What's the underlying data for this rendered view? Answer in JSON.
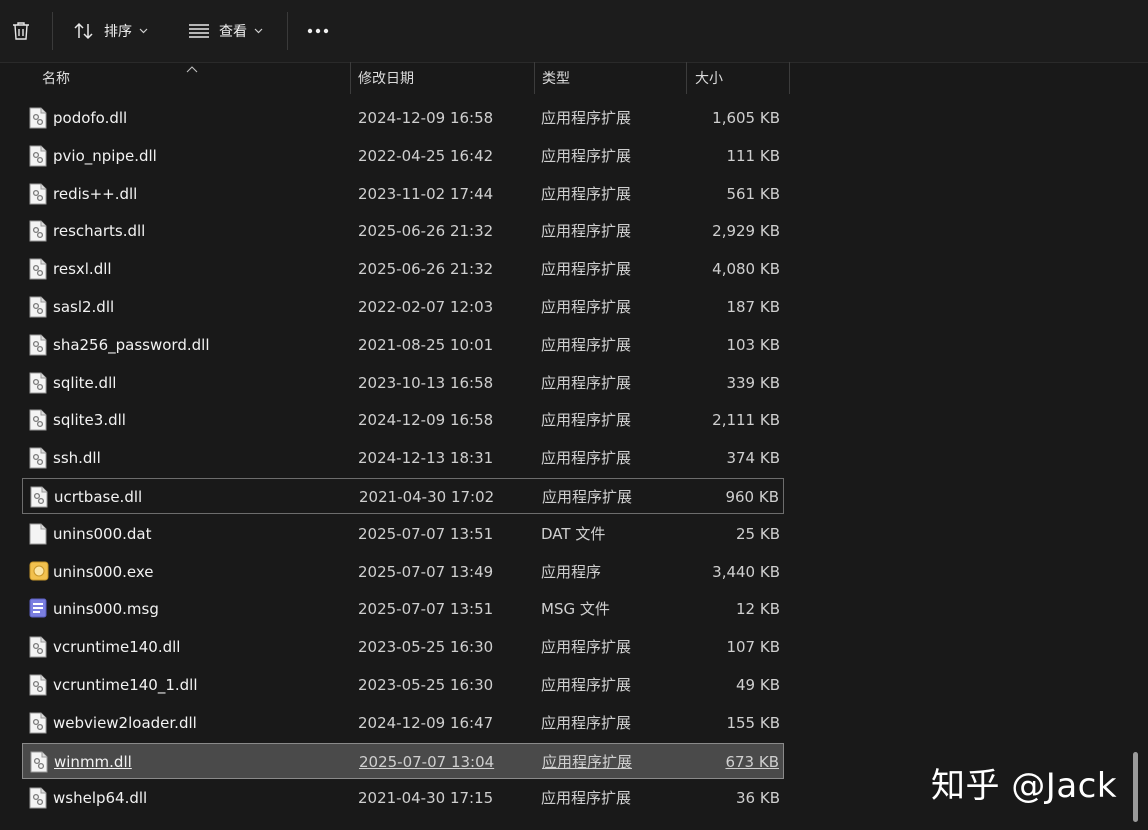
{
  "toolbar": {
    "sort_label": "排序",
    "view_label": "查看"
  },
  "columns": {
    "name": "名称",
    "date": "修改日期",
    "type": "类型",
    "size": "大小"
  },
  "files": [
    {
      "name": "podofo.dll",
      "date": "2024-12-09 16:58",
      "type": "应用程序扩展",
      "size": "1,605 KB",
      "icon": "dll-file-icon"
    },
    {
      "name": "pvio_npipe.dll",
      "date": "2022-04-25 16:42",
      "type": "应用程序扩展",
      "size": "111 KB",
      "icon": "dll-file-icon"
    },
    {
      "name": "redis++.dll",
      "date": "2023-11-02 17:44",
      "type": "应用程序扩展",
      "size": "561 KB",
      "icon": "dll-file-icon"
    },
    {
      "name": "rescharts.dll",
      "date": "2025-06-26 21:32",
      "type": "应用程序扩展",
      "size": "2,929 KB",
      "icon": "dll-file-icon"
    },
    {
      "name": "resxl.dll",
      "date": "2025-06-26 21:32",
      "type": "应用程序扩展",
      "size": "4,080 KB",
      "icon": "dll-file-icon"
    },
    {
      "name": "sasl2.dll",
      "date": "2022-02-07 12:03",
      "type": "应用程序扩展",
      "size": "187 KB",
      "icon": "dll-file-icon"
    },
    {
      "name": "sha256_password.dll",
      "date": "2021-08-25 10:01",
      "type": "应用程序扩展",
      "size": "103 KB",
      "icon": "dll-file-icon"
    },
    {
      "name": "sqlite.dll",
      "date": "2023-10-13 16:58",
      "type": "应用程序扩展",
      "size": "339 KB",
      "icon": "dll-file-icon"
    },
    {
      "name": "sqlite3.dll",
      "date": "2024-12-09 16:58",
      "type": "应用程序扩展",
      "size": "2,111 KB",
      "icon": "dll-file-icon"
    },
    {
      "name": "ssh.dll",
      "date": "2024-12-13 18:31",
      "type": "应用程序扩展",
      "size": "374 KB",
      "icon": "dll-file-icon"
    },
    {
      "name": "ucrtbase.dll",
      "date": "2021-04-30 17:02",
      "type": "应用程序扩展",
      "size": "960 KB",
      "icon": "dll-file-icon",
      "state": "focused"
    },
    {
      "name": "unins000.dat",
      "date": "2025-07-07 13:51",
      "type": "DAT 文件",
      "size": "25 KB",
      "icon": "blank-file-icon"
    },
    {
      "name": "unins000.exe",
      "date": "2025-07-07 13:49",
      "type": "应用程序",
      "size": "3,440 KB",
      "icon": "installer-icon"
    },
    {
      "name": "unins000.msg",
      "date": "2025-07-07 13:51",
      "type": "MSG 文件",
      "size": "12 KB",
      "icon": "message-file-icon"
    },
    {
      "name": "vcruntime140.dll",
      "date": "2023-05-25 16:30",
      "type": "应用程序扩展",
      "size": "107 KB",
      "icon": "dll-file-icon"
    },
    {
      "name": "vcruntime140_1.dll",
      "date": "2023-05-25 16:30",
      "type": "应用程序扩展",
      "size": "49 KB",
      "icon": "dll-file-icon"
    },
    {
      "name": "webview2loader.dll",
      "date": "2024-12-09 16:47",
      "type": "应用程序扩展",
      "size": "155 KB",
      "icon": "dll-file-icon"
    },
    {
      "name": "winmm.dll",
      "date": "2025-07-07 13:04",
      "type": "应用程序扩展",
      "size": "673 KB",
      "icon": "dll-file-icon",
      "state": "selected"
    },
    {
      "name": "wshelp64.dll",
      "date": "2021-04-30 17:15",
      "type": "应用程序扩展",
      "size": "36 KB",
      "icon": "dll-file-icon"
    }
  ],
  "watermark": "知乎 @Jack"
}
